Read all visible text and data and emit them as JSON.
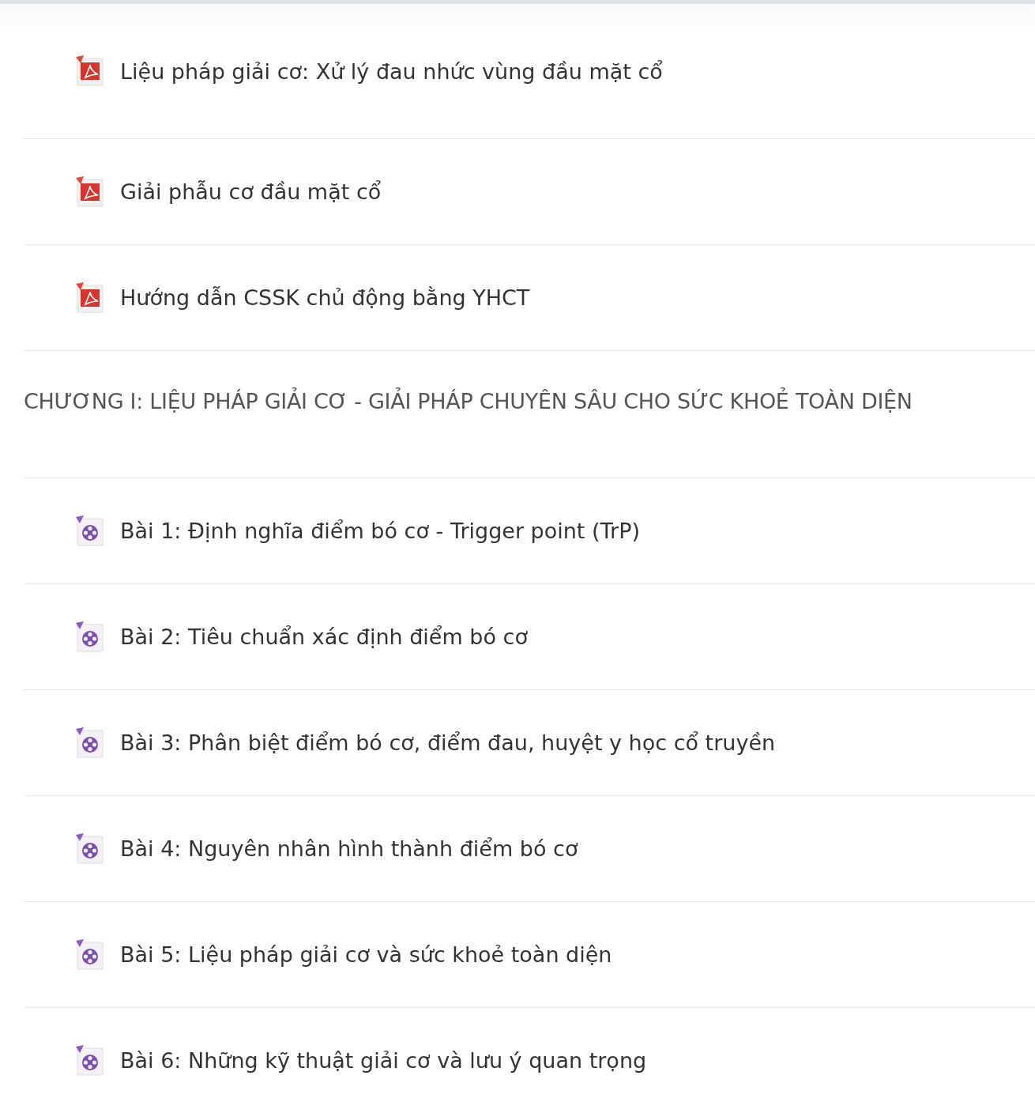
{
  "sections": [
    {
      "items": [
        {
          "kind": "pdf",
          "title": "Liệu pháp giải cơ: Xử lý đau nhức vùng đầu mặt cổ"
        },
        {
          "kind": "pdf",
          "title": "Giải phẫu cơ đầu mặt cổ"
        },
        {
          "kind": "pdf",
          "title": "Hướng dẫn CSSK chủ động bằng YHCT"
        }
      ]
    },
    {
      "heading": "CHƯƠNG I: LIỆU PHÁP GIẢI CƠ - GIẢI PHÁP CHUYÊN SÂU CHO SỨC KHOẺ TOÀN DIỆN",
      "items": [
        {
          "kind": "video",
          "title": "Bài 1: Định nghĩa điểm bó cơ - Trigger point (TrP)"
        },
        {
          "kind": "video",
          "title": "Bài 2: Tiêu chuẩn xác định điểm bó cơ"
        },
        {
          "kind": "video",
          "title": "Bài 3: Phân biệt điểm bó cơ, điểm đau, huyệt y học cổ truyền"
        },
        {
          "kind": "video",
          "title": "Bài 4: Nguyên nhân hình thành điểm bó cơ"
        },
        {
          "kind": "video",
          "title": "Bài 5: Liệu pháp giải cơ và sức khoẻ toàn diện"
        },
        {
          "kind": "video",
          "title": "Bài 6: Những kỹ thuật giải cơ và lưu ý quan trọng"
        }
      ]
    }
  ]
}
